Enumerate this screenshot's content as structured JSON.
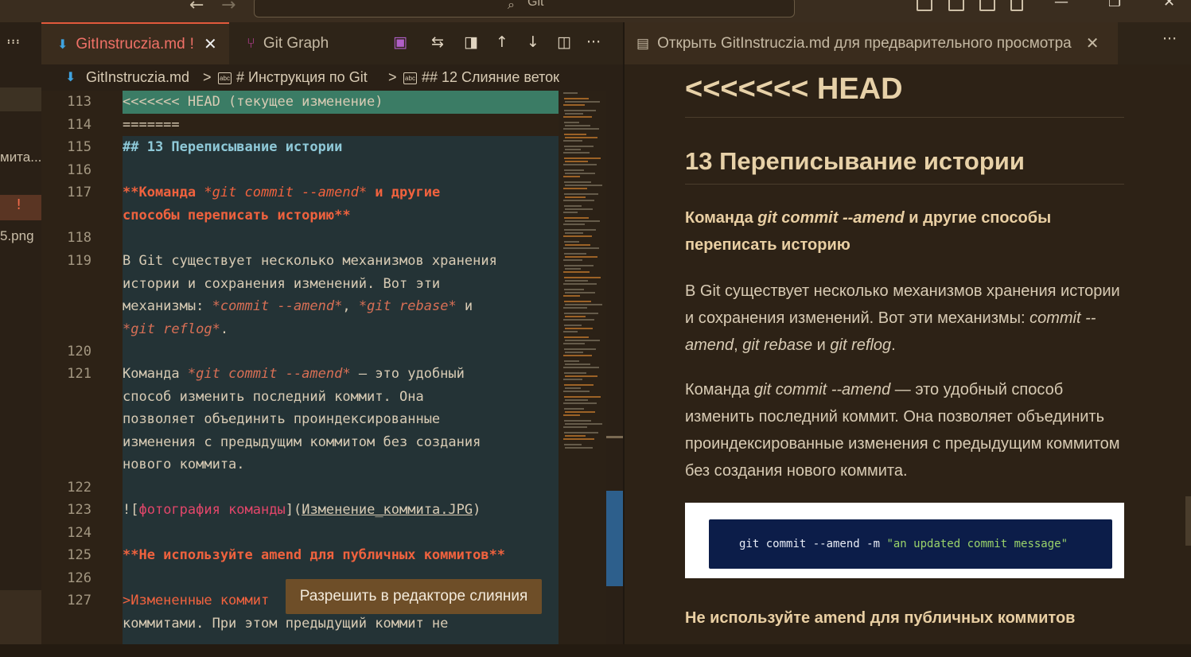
{
  "titlebar": {
    "back_arrow": "←",
    "forward_arrow": "→",
    "search_icon": "⌕",
    "search_label": "Git",
    "minimize": "—",
    "maximize": "❐",
    "close": "✕"
  },
  "sidebar": {
    "more": "···",
    "items": [
      "мита...",
      "5.png"
    ],
    "bang": "!"
  },
  "editor_tabs": {
    "active": {
      "name": "GitInstruczia.md",
      "modified": "!",
      "close": "✕",
      "icon": "⬇"
    },
    "graph": {
      "name": "Git Graph",
      "icon": "⑂"
    },
    "more": "···"
  },
  "breadcrumb": {
    "file": "GitInstruczia.md",
    "sep": ">",
    "section1": "# Инструкция по Git",
    "section2": "## 12 Слияние веток",
    "symbol_icon": "abc"
  },
  "editor": {
    "lines": [
      {
        "no": "113",
        "text": "<<<<<<< HEAD (текущее изменение)"
      },
      {
        "no": "114",
        "text": "======="
      },
      {
        "no": "115",
        "text": "## 13 Переписывание истории"
      },
      {
        "no": "116",
        "text": ""
      },
      {
        "no": "117",
        "text_parts": [
          "**Команда ",
          "*git commit --amend*",
          " и другие",
          "способы переписать историю**"
        ]
      },
      {
        "no": "118",
        "text": ""
      },
      {
        "no": "119",
        "text_parts": [
          "В Git существует несколько механизмов хранения",
          "истории и сохранения изменений. Вот эти",
          "механизмы: ",
          "*commit --amend*",
          ", ",
          "*git rebase*",
          " и",
          "*git reflog*",
          "."
        ]
      },
      {
        "no": "120",
        "text": ""
      },
      {
        "no": "121",
        "text_parts": [
          "Команда ",
          "*git commit --amend*",
          " — это удобный",
          "способ изменить последний коммит. Она",
          "позволяет объединить проиндексированные",
          "изменения с предыдущим коммитом без создания",
          "нового коммита."
        ]
      },
      {
        "no": "122",
        "text": ""
      },
      {
        "no": "123",
        "text_parts": [
          "![",
          "фотография команды",
          "](",
          "Изменение_коммита.JPG",
          ")"
        ]
      },
      {
        "no": "124",
        "text": ""
      },
      {
        "no": "125",
        "text": "**Не используйте amend для публичных коммитов**"
      },
      {
        "no": "126",
        "text": ""
      },
      {
        "no": "127",
        "text_parts": [
          ">Измененные коммит",
          "коммитами. При этом предыдущий коммит не"
        ]
      }
    ],
    "merge_tooltip": "Разрешить в редакторе слияния"
  },
  "preview_tab": {
    "icon": "▤",
    "label": "Открыть GitInstruczia.md для предварительного просмотра",
    "close": "✕",
    "more": "···"
  },
  "preview": {
    "h1": "<<<<<<< HEAD",
    "h2": "13 Переписывание истории",
    "p1_parts": [
      "Команда ",
      "git commit --amend",
      " и другие способы переписать историю"
    ],
    "p2_parts": [
      "В Git существует несколько механизмов хранения истории и сохранения изменений. Вот эти механизмы: ",
      "commit --amend",
      ", ",
      "git rebase",
      " и ",
      "git reflog",
      "."
    ],
    "p3_parts": [
      "Команда ",
      "git commit --amend",
      " — это удобный способ изменить последний коммит. Она позволяет объединить проиндексированные изменения с предыдущим коммитом без создания нового коммита."
    ],
    "image_cmd": "git commit --amend -m ",
    "image_str": "\"an updated commit message\"",
    "p4": "Не используйте amend для публичных коммитов"
  }
}
